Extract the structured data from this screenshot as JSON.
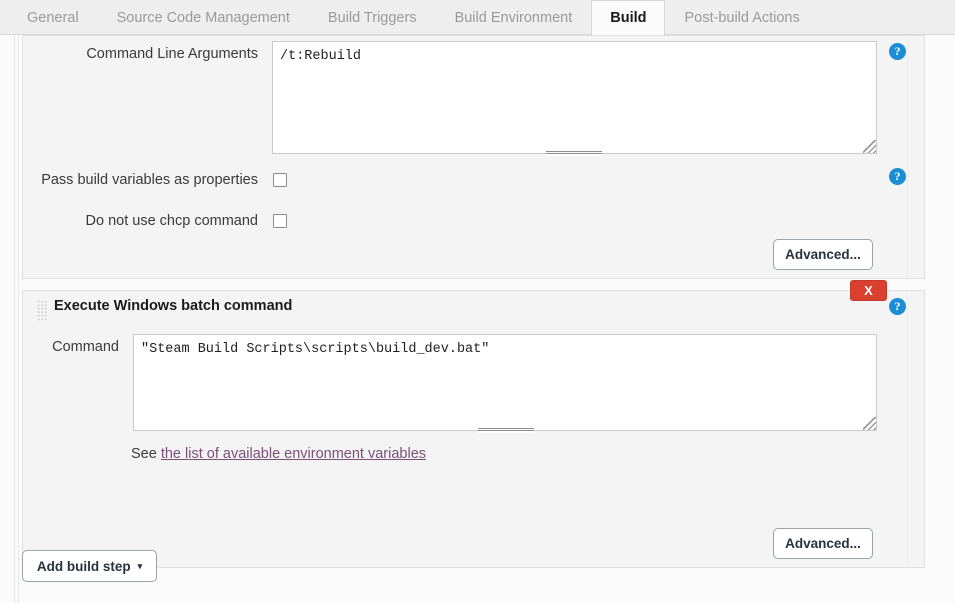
{
  "tabs": [
    {
      "label": "General",
      "active": false
    },
    {
      "label": "Source Code Management",
      "active": false
    },
    {
      "label": "Build Triggers",
      "active": false
    },
    {
      "label": "Build Environment",
      "active": false
    },
    {
      "label": "Build",
      "active": true
    },
    {
      "label": "Post-build Actions",
      "active": false
    }
  ],
  "msbuild_step": {
    "command_line_arguments": {
      "label": "Command Line Arguments",
      "value": "/t:Rebuild",
      "help_icon": "help-icon"
    },
    "pass_build_variables": {
      "label": "Pass build variables as properties",
      "checked": false,
      "help_icon": "help-icon"
    },
    "no_chcp": {
      "label": "Do not use chcp command",
      "checked": false
    },
    "advanced_label": "Advanced..."
  },
  "batch_step": {
    "title": "Execute Windows batch command",
    "drag_handle": "drag-handle-icon",
    "delete_label": "X",
    "help_icon": "help-icon",
    "command": {
      "label": "Command",
      "value": "\"Steam Build Scripts\\scripts\\build_dev.bat\""
    },
    "env_hint": {
      "prefix": "See ",
      "link_text": "the list of available environment variables"
    },
    "advanced_label": "Advanced..."
  },
  "footer": {
    "add_build_step_label": "Add build step",
    "caret": "▾"
  },
  "colors": {
    "accent_blue": "#1b8ed6",
    "danger_red": "#d9412e",
    "link_purple": "#7a4f7a",
    "panel_bg": "#f4f4f4",
    "page_bg": "#fbfbfb"
  }
}
